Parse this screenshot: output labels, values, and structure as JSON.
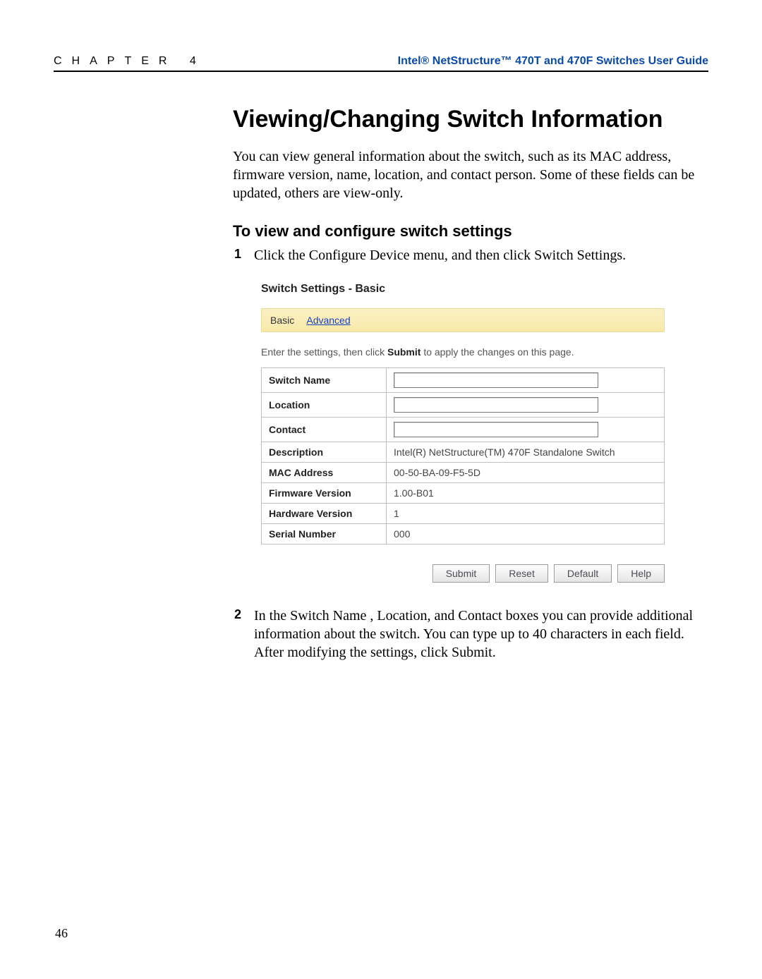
{
  "header": {
    "chapter_label": "CHAPTER 4",
    "guide_title": "Intel® NetStructure™ 470T and 470F Switches User Guide"
  },
  "main": {
    "heading": "Viewing/Changing Switch Information",
    "intro": "You can view general information about the switch, such as its MAC address, firmware version, name, location, and contact person. Some of these fields can be updated, others are view-only.",
    "subheading": "To view and configure switch settings",
    "steps": [
      "Click the Configure Device menu, and then click Switch Settings.",
      "In the Switch Name , Location, and Contact boxes you can provide additional information about the switch. You can type up to 40 characters in each field. After modifying the settings, click Submit."
    ]
  },
  "figure": {
    "title": "Switch Settings - Basic",
    "tabs": {
      "active": "Basic",
      "other": "Advanced"
    },
    "note_pre": "Enter the settings, then click ",
    "note_bold": "Submit",
    "note_post": " to apply the changes on this page.",
    "rows": {
      "switch_name": {
        "label": "Switch Name",
        "value": ""
      },
      "location": {
        "label": "Location",
        "value": ""
      },
      "contact": {
        "label": "Contact",
        "value": ""
      },
      "description": {
        "label": "Description",
        "value": "Intel(R) NetStructure(TM) 470F Standalone Switch"
      },
      "mac_address": {
        "label": "MAC Address",
        "value": "00-50-BA-09-F5-5D"
      },
      "firmware": {
        "label": "Firmware Version",
        "value": "1.00-B01"
      },
      "hardware": {
        "label": "Hardware Version",
        "value": "1"
      },
      "serial": {
        "label": "Serial Number",
        "value": "000"
      }
    },
    "buttons": {
      "submit": "Submit",
      "reset": "Reset",
      "default": "Default",
      "help": "Help"
    }
  },
  "page_number": "46"
}
